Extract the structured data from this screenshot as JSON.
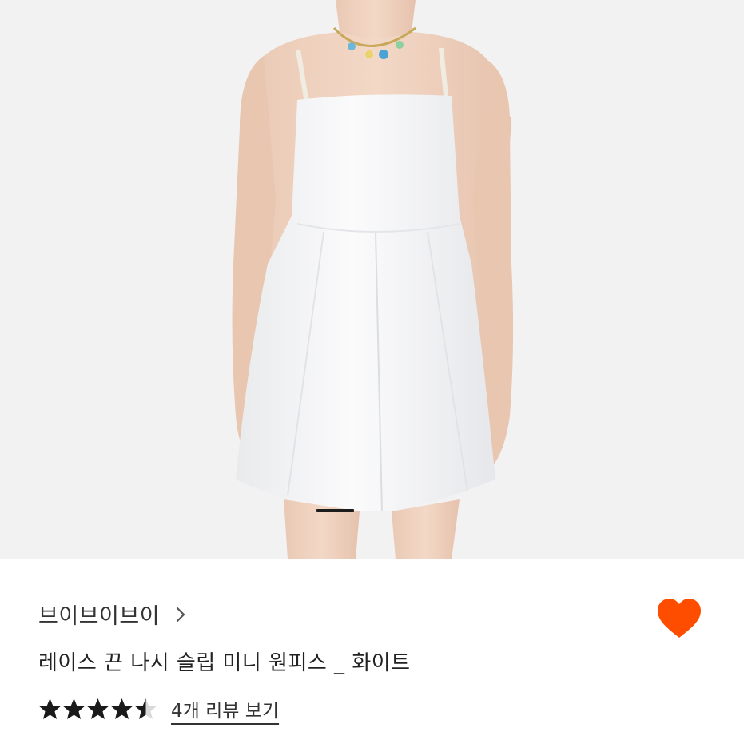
{
  "product": {
    "shop_name": "브이브이브이",
    "title": "레이스 끈 나시 슬립 미니 원피스 _ 화이트",
    "reviews_link": "4개 리뷰 보기",
    "rating": 4.5,
    "rating_max": 5,
    "image_index": 1,
    "liked": true
  },
  "icons": {
    "shop_chevron": "chevron-right-icon",
    "like": "heart-icon",
    "star": "star-icon"
  },
  "colors": {
    "heart": "#FF4D00",
    "star": "#1A1A1A",
    "star_empty": "#D9D9D9",
    "image_background": "#F2F2F3",
    "indicator": "#1C1C1C"
  }
}
